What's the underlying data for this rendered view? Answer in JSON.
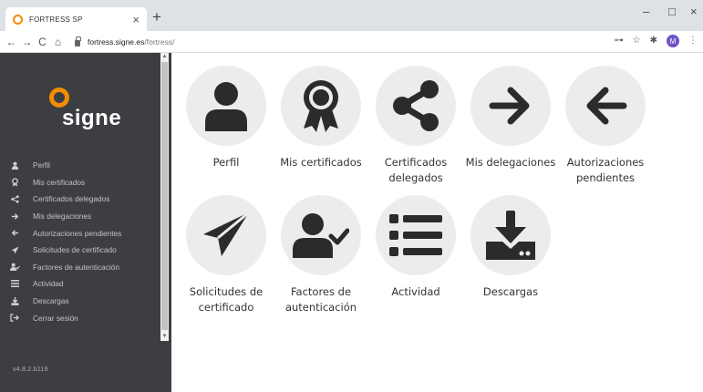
{
  "browser": {
    "tab_title": "FORTRESS SP",
    "tab_close": "×",
    "new_tab": "+",
    "url_host": "fortress.signe.es",
    "url_path": "/fortress/",
    "profile_initial": "M",
    "window_controls": {
      "minimize": "–",
      "maximize": "□",
      "close": "×"
    },
    "nav": {
      "back": "←",
      "forward": "→",
      "reload": "C",
      "home": "⌂"
    },
    "toolbar_icons": {
      "key": "⊶",
      "star": "☆",
      "extensions": "✱",
      "menu": "⋮"
    }
  },
  "brand": {
    "logo_text": "signe",
    "accent_color": "#f28c00"
  },
  "sidebar": {
    "background": "#3c3e42",
    "items": [
      {
        "label": "Perfil",
        "icon": "user-icon",
        "glyph": "👤"
      },
      {
        "label": "Mis certificados",
        "icon": "award-icon",
        "glyph": "✪"
      },
      {
        "label": "Certificados delegados",
        "icon": "share-icon",
        "glyph": "<"
      },
      {
        "label": "Mis delegaciones",
        "icon": "arrow-right-icon",
        "glyph": "→"
      },
      {
        "label": "Autorizaciones pendientes",
        "icon": "arrow-left-icon",
        "glyph": "←"
      },
      {
        "label": "Solicitudes de certificado",
        "icon": "paper-plane-icon",
        "glyph": "➤"
      },
      {
        "label": "Factores de autenticación",
        "icon": "user-check-icon",
        "glyph": "👤"
      },
      {
        "label": "Actividad",
        "icon": "list-icon",
        "glyph": "☰"
      },
      {
        "label": "Descargas",
        "icon": "download-icon",
        "glyph": "⤓"
      },
      {
        "label": "Cerrar sesión",
        "icon": "logout-icon",
        "glyph": "⇥"
      }
    ],
    "version": "v4.8.2.b119"
  },
  "tiles": [
    {
      "label": "Perfil",
      "icon": "user-icon"
    },
    {
      "label": "Mis certificados",
      "icon": "award-icon"
    },
    {
      "label": "Certificados delegados",
      "icon": "share-icon"
    },
    {
      "label": "Mis delegaciones",
      "icon": "arrow-right-icon"
    },
    {
      "label": "Autorizaciones pendientes",
      "icon": "arrow-left-icon"
    },
    {
      "label": "Solicitudes de certificado",
      "icon": "paper-plane-icon"
    },
    {
      "label": "Factores de autenticación",
      "icon": "user-check-icon"
    },
    {
      "label": "Actividad",
      "icon": "list-icon"
    },
    {
      "label": "Descargas",
      "icon": "download-icon"
    }
  ]
}
